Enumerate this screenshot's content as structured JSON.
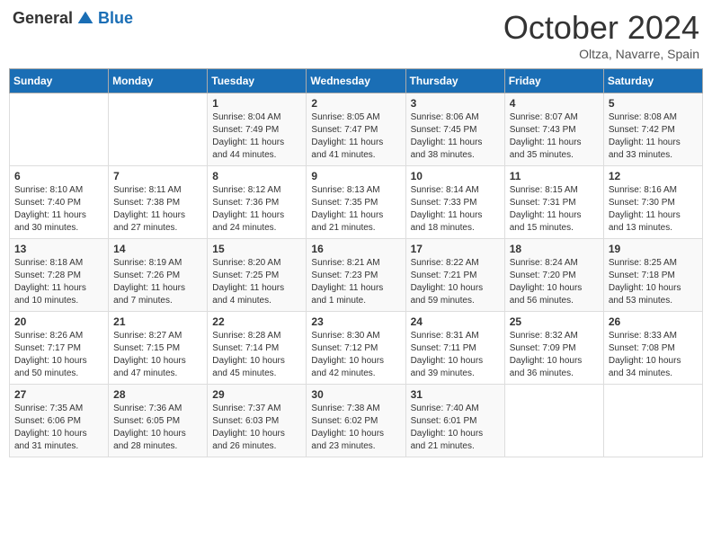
{
  "header": {
    "logo_general": "General",
    "logo_blue": "Blue",
    "title": "October 2024",
    "subtitle": "Oltza, Navarre, Spain"
  },
  "days_of_week": [
    "Sunday",
    "Monday",
    "Tuesday",
    "Wednesday",
    "Thursday",
    "Friday",
    "Saturday"
  ],
  "weeks": [
    [
      {
        "day": "",
        "info": ""
      },
      {
        "day": "",
        "info": ""
      },
      {
        "day": "1",
        "info": "Sunrise: 8:04 AM\nSunset: 7:49 PM\nDaylight: 11 hours and 44 minutes."
      },
      {
        "day": "2",
        "info": "Sunrise: 8:05 AM\nSunset: 7:47 PM\nDaylight: 11 hours and 41 minutes."
      },
      {
        "day": "3",
        "info": "Sunrise: 8:06 AM\nSunset: 7:45 PM\nDaylight: 11 hours and 38 minutes."
      },
      {
        "day": "4",
        "info": "Sunrise: 8:07 AM\nSunset: 7:43 PM\nDaylight: 11 hours and 35 minutes."
      },
      {
        "day": "5",
        "info": "Sunrise: 8:08 AM\nSunset: 7:42 PM\nDaylight: 11 hours and 33 minutes."
      }
    ],
    [
      {
        "day": "6",
        "info": "Sunrise: 8:10 AM\nSunset: 7:40 PM\nDaylight: 11 hours and 30 minutes."
      },
      {
        "day": "7",
        "info": "Sunrise: 8:11 AM\nSunset: 7:38 PM\nDaylight: 11 hours and 27 minutes."
      },
      {
        "day": "8",
        "info": "Sunrise: 8:12 AM\nSunset: 7:36 PM\nDaylight: 11 hours and 24 minutes."
      },
      {
        "day": "9",
        "info": "Sunrise: 8:13 AM\nSunset: 7:35 PM\nDaylight: 11 hours and 21 minutes."
      },
      {
        "day": "10",
        "info": "Sunrise: 8:14 AM\nSunset: 7:33 PM\nDaylight: 11 hours and 18 minutes."
      },
      {
        "day": "11",
        "info": "Sunrise: 8:15 AM\nSunset: 7:31 PM\nDaylight: 11 hours and 15 minutes."
      },
      {
        "day": "12",
        "info": "Sunrise: 8:16 AM\nSunset: 7:30 PM\nDaylight: 11 hours and 13 minutes."
      }
    ],
    [
      {
        "day": "13",
        "info": "Sunrise: 8:18 AM\nSunset: 7:28 PM\nDaylight: 11 hours and 10 minutes."
      },
      {
        "day": "14",
        "info": "Sunrise: 8:19 AM\nSunset: 7:26 PM\nDaylight: 11 hours and 7 minutes."
      },
      {
        "day": "15",
        "info": "Sunrise: 8:20 AM\nSunset: 7:25 PM\nDaylight: 11 hours and 4 minutes."
      },
      {
        "day": "16",
        "info": "Sunrise: 8:21 AM\nSunset: 7:23 PM\nDaylight: 11 hours and 1 minute."
      },
      {
        "day": "17",
        "info": "Sunrise: 8:22 AM\nSunset: 7:21 PM\nDaylight: 10 hours and 59 minutes."
      },
      {
        "day": "18",
        "info": "Sunrise: 8:24 AM\nSunset: 7:20 PM\nDaylight: 10 hours and 56 minutes."
      },
      {
        "day": "19",
        "info": "Sunrise: 8:25 AM\nSunset: 7:18 PM\nDaylight: 10 hours and 53 minutes."
      }
    ],
    [
      {
        "day": "20",
        "info": "Sunrise: 8:26 AM\nSunset: 7:17 PM\nDaylight: 10 hours and 50 minutes."
      },
      {
        "day": "21",
        "info": "Sunrise: 8:27 AM\nSunset: 7:15 PM\nDaylight: 10 hours and 47 minutes."
      },
      {
        "day": "22",
        "info": "Sunrise: 8:28 AM\nSunset: 7:14 PM\nDaylight: 10 hours and 45 minutes."
      },
      {
        "day": "23",
        "info": "Sunrise: 8:30 AM\nSunset: 7:12 PM\nDaylight: 10 hours and 42 minutes."
      },
      {
        "day": "24",
        "info": "Sunrise: 8:31 AM\nSunset: 7:11 PM\nDaylight: 10 hours and 39 minutes."
      },
      {
        "day": "25",
        "info": "Sunrise: 8:32 AM\nSunset: 7:09 PM\nDaylight: 10 hours and 36 minutes."
      },
      {
        "day": "26",
        "info": "Sunrise: 8:33 AM\nSunset: 7:08 PM\nDaylight: 10 hours and 34 minutes."
      }
    ],
    [
      {
        "day": "27",
        "info": "Sunrise: 7:35 AM\nSunset: 6:06 PM\nDaylight: 10 hours and 31 minutes."
      },
      {
        "day": "28",
        "info": "Sunrise: 7:36 AM\nSunset: 6:05 PM\nDaylight: 10 hours and 28 minutes."
      },
      {
        "day": "29",
        "info": "Sunrise: 7:37 AM\nSunset: 6:03 PM\nDaylight: 10 hours and 26 minutes."
      },
      {
        "day": "30",
        "info": "Sunrise: 7:38 AM\nSunset: 6:02 PM\nDaylight: 10 hours and 23 minutes."
      },
      {
        "day": "31",
        "info": "Sunrise: 7:40 AM\nSunset: 6:01 PM\nDaylight: 10 hours and 21 minutes."
      },
      {
        "day": "",
        "info": ""
      },
      {
        "day": "",
        "info": ""
      }
    ]
  ]
}
